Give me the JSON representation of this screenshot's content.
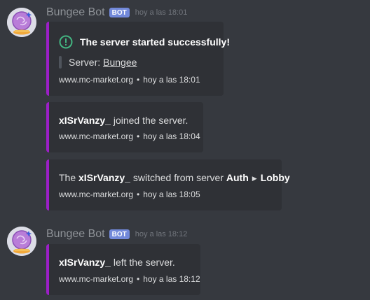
{
  "colors": {
    "background": "#36393f",
    "embed_bg": "#2f3136",
    "accent_bar": "#9c1fc7",
    "bot_tag": "#7289da",
    "success": "#43b581"
  },
  "groups": [
    {
      "username": "Bungee Bot",
      "bot_tag": "BOT",
      "timestamp": "hoy a las 18:01",
      "avatar_icon": "crystal-ball-avatar"
    },
    {
      "username": "Bungee Bot",
      "bot_tag": "BOT",
      "timestamp": "hoy a las 18:12",
      "avatar_icon": "crystal-ball-avatar"
    }
  ],
  "embeds": [
    {
      "title": "The server started successfully!",
      "icon": "check-circle-icon",
      "field_label": "Server:",
      "field_link": "Bungee",
      "footer_site": "www.mc-market.org",
      "footer_sep": "•",
      "footer_time": "hoy a las 18:01"
    },
    {
      "player": "xISrVanzy_",
      "text": "joined the server.",
      "footer_site": "www.mc-market.org",
      "footer_sep": "•",
      "footer_time": "hoy a las 18:04"
    },
    {
      "prefix": "The",
      "player": "xISrVanzy_",
      "text": "switched from server",
      "from": "Auth",
      "arrow": "▶",
      "to": "Lobby",
      "footer_site": "www.mc-market.org",
      "footer_sep": "•",
      "footer_time": "hoy a las 18:05"
    },
    {
      "player": "xISrVanzy_",
      "text": "left the server.",
      "footer_site": "www.mc-market.org",
      "footer_sep": "•",
      "footer_time": "hoy a las 18:12"
    }
  ]
}
